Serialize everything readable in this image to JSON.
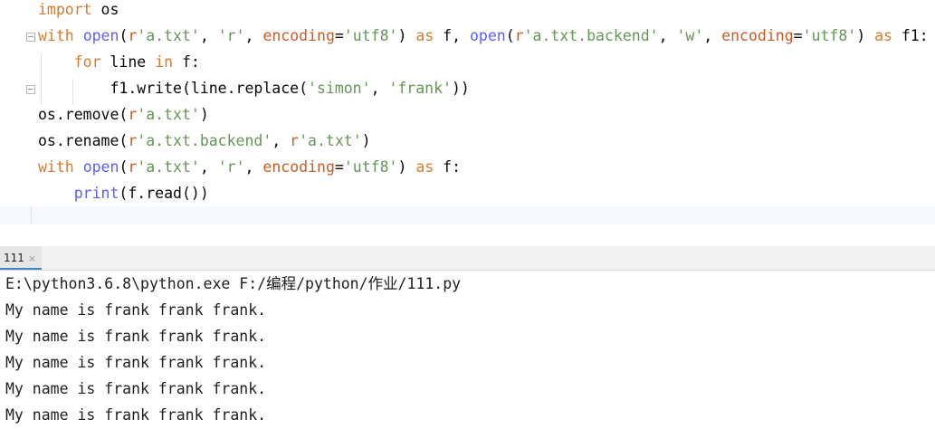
{
  "editor": {
    "lines": [
      {
        "segments": [
          {
            "t": "import",
            "c": "k"
          },
          {
            "t": " os",
            "c": "plain"
          }
        ]
      },
      {
        "segments": [
          {
            "t": "with",
            "c": "k"
          },
          {
            "t": " ",
            "c": "plain"
          },
          {
            "t": "open",
            "c": "b"
          },
          {
            "t": "(",
            "c": "plain"
          },
          {
            "t": "r",
            "c": "r"
          },
          {
            "t": "'a.txt'",
            "c": "s"
          },
          {
            "t": ", ",
            "c": "plain"
          },
          {
            "t": "'r'",
            "c": "s"
          },
          {
            "t": ", ",
            "c": "plain"
          },
          {
            "t": "encoding",
            "c": "p"
          },
          {
            "t": "=",
            "c": "plain"
          },
          {
            "t": "'utf8'",
            "c": "s"
          },
          {
            "t": ") ",
            "c": "plain"
          },
          {
            "t": "as",
            "c": "k"
          },
          {
            "t": " f, ",
            "c": "plain"
          },
          {
            "t": "open",
            "c": "b"
          },
          {
            "t": "(",
            "c": "plain"
          },
          {
            "t": "r",
            "c": "r"
          },
          {
            "t": "'a.txt.backend'",
            "c": "s"
          },
          {
            "t": ", ",
            "c": "plain"
          },
          {
            "t": "'w'",
            "c": "s"
          },
          {
            "t": ", ",
            "c": "plain"
          },
          {
            "t": "encoding",
            "c": "p"
          },
          {
            "t": "=",
            "c": "plain"
          },
          {
            "t": "'utf8'",
            "c": "s"
          },
          {
            "t": ") ",
            "c": "plain"
          },
          {
            "t": "as",
            "c": "k"
          },
          {
            "t": " f1:",
            "c": "plain"
          }
        ]
      },
      {
        "segments": [
          {
            "t": "    ",
            "c": "plain"
          },
          {
            "t": "for",
            "c": "k"
          },
          {
            "t": " line ",
            "c": "plain"
          },
          {
            "t": "in",
            "c": "k"
          },
          {
            "t": " f:",
            "c": "plain"
          }
        ]
      },
      {
        "segments": [
          {
            "t": "        f1.write(line.replace(",
            "c": "plain"
          },
          {
            "t": "'simon'",
            "c": "s"
          },
          {
            "t": ", ",
            "c": "plain"
          },
          {
            "t": "'frank'",
            "c": "s"
          },
          {
            "t": "))",
            "c": "plain"
          }
        ]
      },
      {
        "segments": [
          {
            "t": "os.remove(",
            "c": "plain"
          },
          {
            "t": "r",
            "c": "r"
          },
          {
            "t": "'a.txt'",
            "c": "s"
          },
          {
            "t": ")",
            "c": "plain"
          }
        ]
      },
      {
        "segments": [
          {
            "t": "os.rename(",
            "c": "plain"
          },
          {
            "t": "r",
            "c": "r"
          },
          {
            "t": "'a.txt.backend'",
            "c": "s"
          },
          {
            "t": ", ",
            "c": "plain"
          },
          {
            "t": "r",
            "c": "r"
          },
          {
            "t": "'a.txt'",
            "c": "s"
          },
          {
            "t": ")",
            "c": "plain"
          }
        ]
      },
      {
        "segments": [
          {
            "t": "with",
            "c": "k"
          },
          {
            "t": " ",
            "c": "plain"
          },
          {
            "t": "open",
            "c": "b"
          },
          {
            "t": "(",
            "c": "plain"
          },
          {
            "t": "r",
            "c": "r"
          },
          {
            "t": "'a.txt'",
            "c": "s"
          },
          {
            "t": ", ",
            "c": "plain"
          },
          {
            "t": "'r'",
            "c": "s"
          },
          {
            "t": ", ",
            "c": "plain"
          },
          {
            "t": "encoding",
            "c": "p"
          },
          {
            "t": "=",
            "c": "plain"
          },
          {
            "t": "'utf8'",
            "c": "s"
          },
          {
            "t": ") ",
            "c": "plain"
          },
          {
            "t": "as",
            "c": "k"
          },
          {
            "t": " f:",
            "c": "plain"
          }
        ]
      },
      {
        "segments": [
          {
            "t": "    ",
            "c": "plain"
          },
          {
            "t": "print",
            "c": "b"
          },
          {
            "t": "(f.read())",
            "c": "plain"
          }
        ]
      }
    ]
  },
  "run_panel": {
    "tab_label": "111",
    "tab_close": "×",
    "close_icon": "close-icon"
  },
  "console": {
    "lines": [
      "E:\\python3.6.8\\python.exe F:/编程/python/作业/111.py",
      "My name is frank frank frank.",
      "My name is frank frank frank.",
      "My name is frank frank frank.",
      "My name is frank frank frank.",
      "My name is frank frank frank."
    ]
  }
}
